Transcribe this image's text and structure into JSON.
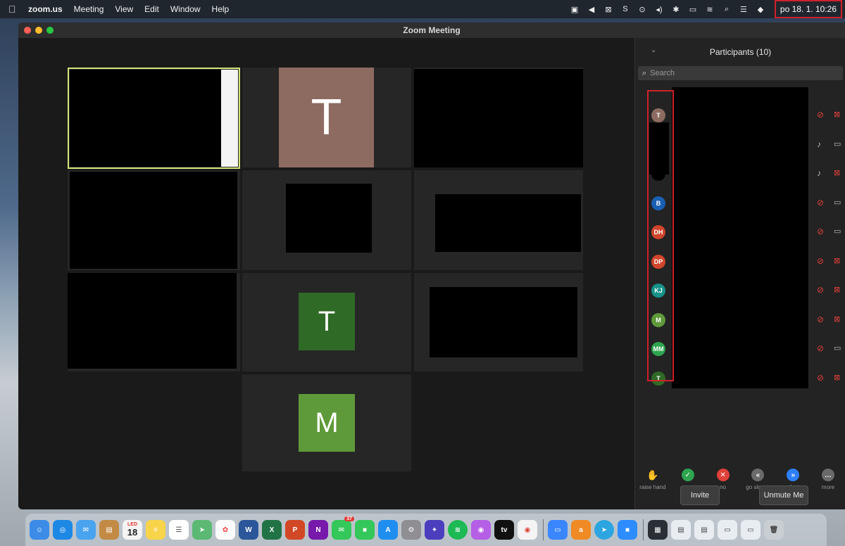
{
  "menubar": {
    "apple_icon": "apple-icon",
    "items": [
      "zoom.us",
      "Meeting",
      "View",
      "Edit",
      "Window",
      "Help"
    ],
    "clock": "po 18. 1.  10:26"
  },
  "window": {
    "title": "Zoom Meeting"
  },
  "gallery": {
    "tiles": [
      {
        "initial": ""
      },
      {
        "initial": "T",
        "color": "#8d6b61"
      },
      {
        "initial": ""
      },
      {
        "initial": ""
      },
      {
        "initial": ""
      },
      {
        "initial": ""
      },
      {
        "initial": ""
      },
      {
        "initial": "T",
        "color": "#2f6a26"
      },
      {
        "initial": ""
      },
      {
        "initial": "M",
        "color": "#5f9a3a"
      }
    ]
  },
  "participants": {
    "title": "Participants (10)",
    "search_placeholder": "Search",
    "rows": [
      {
        "initials": "T",
        "color": "#8d6b61",
        "mic": "muted",
        "cam": "off"
      },
      {
        "initials": "",
        "color": "#000000",
        "mic": "on",
        "cam": "on"
      },
      {
        "initials": "",
        "color": "#000000",
        "mic": "on",
        "cam": "off"
      },
      {
        "initials": "B",
        "color": "#1a5fb4",
        "mic": "muted",
        "cam": "on"
      },
      {
        "initials": "DH",
        "color": "#d0452b",
        "mic": "muted",
        "cam": "on"
      },
      {
        "initials": "DP",
        "color": "#d0452b",
        "mic": "muted",
        "cam": "off"
      },
      {
        "initials": "KJ",
        "color": "#17918a",
        "mic": "muted",
        "cam": "off"
      },
      {
        "initials": "M",
        "color": "#5f9a3a",
        "mic": "muted",
        "cam": "off"
      },
      {
        "initials": "MM",
        "color": "#2ea44f",
        "mic": "muted",
        "cam": "on"
      },
      {
        "initials": "T",
        "color": "#2f6a26",
        "mic": "muted",
        "cam": "off"
      }
    ],
    "reactions": [
      {
        "label": "raise hand",
        "color": "#2d7ff9",
        "glyph": "✋"
      },
      {
        "label": "yes",
        "color": "#2ea44f",
        "glyph": "✓"
      },
      {
        "label": "no",
        "color": "#e0403a",
        "glyph": "✕"
      },
      {
        "label": "go slower",
        "color": "#6a6a6a",
        "glyph": "«"
      },
      {
        "label": "go faster",
        "color": "#2d7ff9",
        "glyph": "»"
      },
      {
        "label": "more",
        "color": "#6a6a6a",
        "glyph": "…"
      }
    ],
    "invite_label": "Invite",
    "unmute_label": "Unmute Me"
  },
  "dock": {
    "calendar_month": "LED",
    "calendar_day": "18",
    "messages_badge": "37"
  },
  "colors": {
    "accent_red": "#d0202a",
    "active_speaker": "#d6e27a",
    "muted_red": "#e0403a"
  }
}
